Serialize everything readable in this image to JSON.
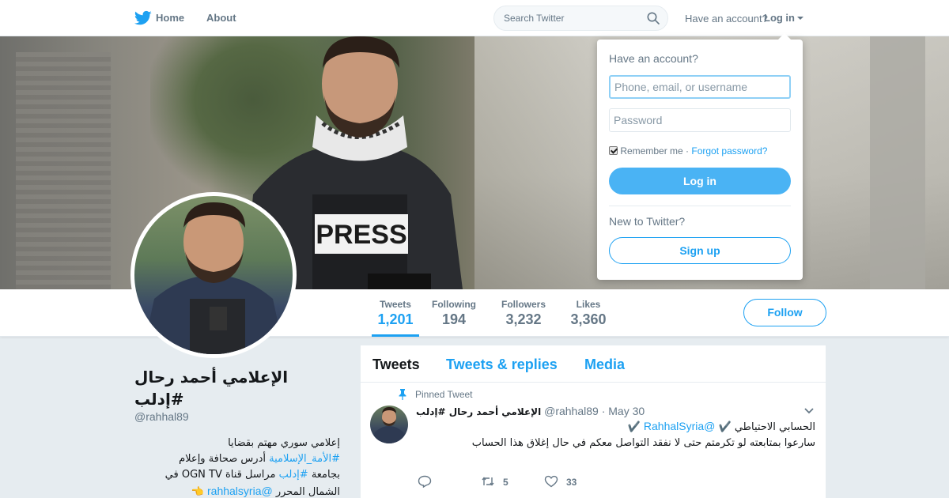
{
  "nav": {
    "home_label": "Home",
    "about_label": "About",
    "search_placeholder": "Search Twitter",
    "have_account": "Have an account?",
    "login_label": "Log in"
  },
  "stats": [
    {
      "label": "Tweets",
      "value": "1,201"
    },
    {
      "label": "Following",
      "value": "194"
    },
    {
      "label": "Followers",
      "value": "3,232"
    },
    {
      "label": "Likes",
      "value": "3,360"
    }
  ],
  "follow_label": "Follow",
  "profile": {
    "name": "الإعلامي أحمد رحال #إدلب",
    "handle": "@rahhal89",
    "bio": {
      "line1": "إعلامي سوري مهتم بقضايا",
      "line2_tag": "#الأمة_الإسلامية",
      "line2_rest": " أدرس صحافة وإعلام",
      "line3_a": "بجامعة ",
      "line3_tag": "#إدلب",
      "line3_rest": " مراسل قناة OGN TV في",
      "line4_text": "الشمال المحرر ",
      "line4_mention": "@rahhalsyria",
      "line4_emoji": "👈"
    }
  },
  "timeline": {
    "tabs": [
      "Tweets",
      "Tweets & replies",
      "Media"
    ],
    "tweet": {
      "pinned_label": "Pinned Tweet",
      "name": "الإعلامي أحمد رحال #إدلب",
      "handle": "@rahhal89",
      "date": "May 30",
      "line1_text": "الحسابي الاحتياطي ✔️",
      "line1_mention": "@RahhalSyria",
      "line1_end": " ✔️",
      "line2": "سارعوا بمتابعته لو تكرمتم حتى لا نفقد التواصل معكم في حال إغلاق هذا الحساب",
      "retweets": "5",
      "likes": "33"
    }
  },
  "login_dropdown": {
    "title": "Have an account?",
    "username_placeholder": "Phone, email, or username",
    "password_placeholder": "Password",
    "remember_label": "Remember me",
    "separator": " · ",
    "forgot_label": "Forgot password?",
    "login_button": "Log in",
    "new_label": "New to Twitter?",
    "signup_button": "Sign up"
  },
  "colors": {
    "accent": "#1da1f2",
    "login_button": "#4ab3f4",
    "muted": "#657786",
    "background": "#e6ecf0"
  }
}
